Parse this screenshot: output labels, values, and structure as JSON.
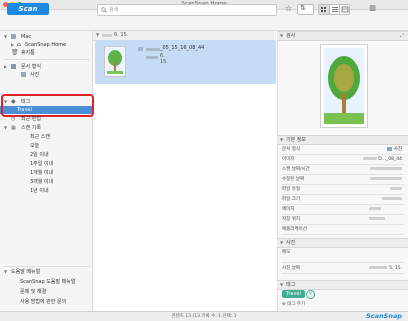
{
  "window": {
    "title": "ScanSnap Home"
  },
  "toolbar": {
    "scan_label": "Scan",
    "search_placeholder": "검색",
    "icons": [
      "star-icon",
      "sort-icon",
      "grid-view-icon",
      "list-view-icon",
      "detail-view-icon",
      "panel-icon"
    ]
  },
  "sidebar": {
    "mac_label": "Mac",
    "scansnap_home_label": "ScanSnap Home",
    "trash_label": "휴지통",
    "doc_type_label": "문서 형식",
    "doc_type_children": [
      "",
      ""
    ],
    "doc_type_sub2": "사진",
    "tag_label": "태그",
    "travel_label": "Travel",
    "recent_label": "최근 편집",
    "scan_date_label": "스캔 기록",
    "scan_date_items": [
      "최근 스캔",
      "오늘",
      "2일 이내",
      "1주일 이내",
      "1개월 이내",
      "3개월 이내",
      "1년 이내"
    ],
    "help_label": "도움말 메뉴얼",
    "help_items": [
      "ScanSnap 도움말 매뉴얼",
      "문제 및 해결",
      "사용 방법에 관한 문의"
    ]
  },
  "list": {
    "group_header": "6. 15.",
    "item": {
      "filename": "_05_15_16_08_44",
      "date": "6. 15."
    }
  },
  "right": {
    "preview_header": "검사",
    "basic_info_header": "기본 정보",
    "rows": [
      {
        "k": "문서 형식",
        "v": "사진"
      },
      {
        "k": "이미지",
        "v": "D..._08_44"
      },
      {
        "k": "스캔 날짜/시간",
        "v": ""
      },
      {
        "k": "수정된 날짜",
        "v": ""
      },
      {
        "k": "파일 유형",
        "v": ""
      },
      {
        "k": "파일 크기",
        "v": ""
      },
      {
        "k": "페이지",
        "v": ""
      },
      {
        "k": "저장 위치",
        "v": ""
      },
      {
        "k": "애플리케이션",
        "v": ""
      }
    ],
    "photo_header": "사진",
    "photo_rows": [
      {
        "k": "메모",
        "v": ""
      },
      {
        "k": "사진 날짜",
        "v": "5. 15."
      }
    ],
    "tag_header": "태그",
    "tag_value": "Travel",
    "add_tag_label": "태그 추가"
  },
  "status": {
    "text": "콘텐츠 13 (13 기록 수: 1 선택: 1",
    "brand": "ScanSnap"
  },
  "colors": {
    "accent": "#1e88e5",
    "selection": "#4a90d9",
    "highlight": "#e0202a"
  }
}
